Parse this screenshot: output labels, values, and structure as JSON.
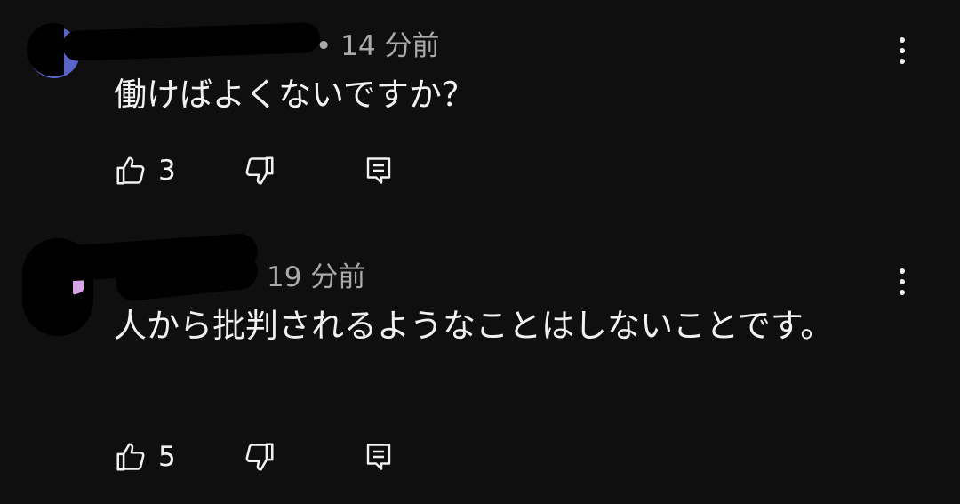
{
  "comments": [
    {
      "time": "• 14 分前",
      "text": "働けばよくないですか？",
      "likes": "3"
    },
    {
      "time": "19 分前",
      "text": "人から批判されるようなことはしないことです。",
      "likes": "5"
    }
  ],
  "colors": {
    "background": "#0f0f0f",
    "text": "#f1f1f1",
    "meta": "#aaaaaa",
    "avatar1": "#5a63c8"
  },
  "icons": [
    "like-icon",
    "dislike-icon",
    "reply-icon",
    "more-vert-icon"
  ]
}
